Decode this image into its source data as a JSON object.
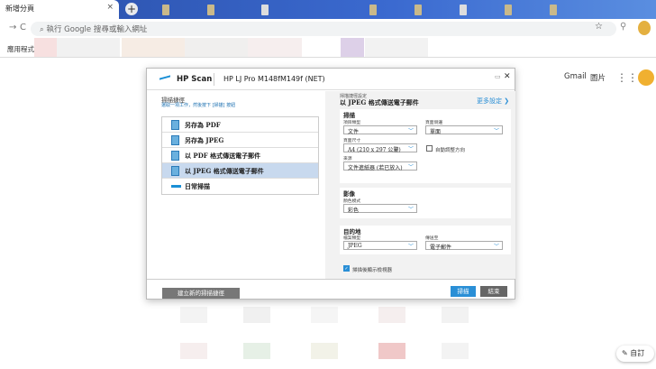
{
  "browser": {
    "tab_title": "新增分頁",
    "tab_close": "×",
    "new_tab": "+",
    "omnibox_placeholder": "執行 Google 搜尋或輸入網址",
    "back": "←",
    "forward": "→",
    "reload": "C",
    "star": "☆",
    "extension": "⚲",
    "bookmarks_apps": "應用程式"
  },
  "ntp": {
    "gmail": "Gmail",
    "images": "圖片",
    "apps_icon": "⋮⋮⋮",
    "customize": "✎ 自訂"
  },
  "dialog": {
    "brand": "HP Scan",
    "device": "HP LJ Pro M148fM149f (NET)",
    "minimize": "▭",
    "close": "✕",
    "left": {
      "heading": "掃描捷徑",
      "subtitle": "選取一項工作，然後按下 [掃描] 按鈕",
      "shortcuts": [
        {
          "label": "另存為 PDF",
          "selected": false
        },
        {
          "label": "另存為 JPEG",
          "selected": false
        },
        {
          "label": "以 PDF 格式傳送電子郵件",
          "selected": false
        },
        {
          "label": "以 JPEG 格式傳送電子郵件",
          "selected": true
        },
        {
          "label": "日常掃描",
          "selected": false
        }
      ],
      "new_shortcut": "建立新的掃描捷徑"
    },
    "right": {
      "settings_heading": "掃描捷徑設定",
      "title": "以 JPEG 格式傳送電子郵件",
      "more_settings": "更多設定 ❯",
      "scan": {
        "title": "掃描",
        "item_type_label": "項目類型",
        "item_type": "文件",
        "page_sides_label": "頁面側邊",
        "page_sides": "單面",
        "page_size_label": "頁面尺寸",
        "page_size": "A4 (210 x 297 公釐)",
        "auto_orient": "自動調整方向",
        "auto_orient_checked": false,
        "source_label": "來源",
        "source": "文件進紙器 (若已放入)"
      },
      "image": {
        "title": "影像",
        "color_mode_label": "顏色模式",
        "color_mode": "彩色"
      },
      "destination": {
        "title": "目的地",
        "file_type_label": "檔案類型",
        "file_type": "JPEG",
        "send_to_label": "傳送至",
        "send_to": "電子郵件"
      },
      "show_viewer": "掃描後顯示檢視器",
      "show_viewer_checked": true
    },
    "footer": {
      "scan": "掃描",
      "finish": "結束"
    }
  }
}
